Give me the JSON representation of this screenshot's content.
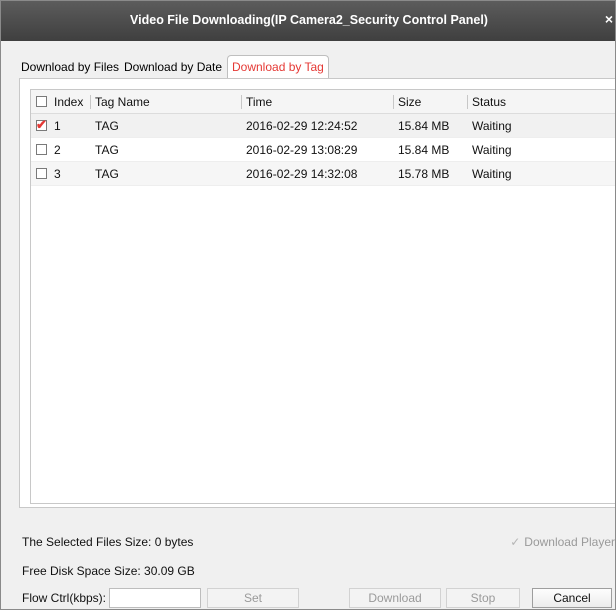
{
  "window": {
    "title": "Video File Downloading(IP Camera2_Security Control Panel)",
    "close_symbol": "×"
  },
  "tabs": [
    {
      "label": "Download by Files",
      "active": false
    },
    {
      "label": "Download by Date",
      "active": false
    },
    {
      "label": "Download by Tag",
      "active": true
    }
  ],
  "table": {
    "columns": {
      "index": "Index",
      "tag_name": "Tag Name",
      "time": "Time",
      "size": "Size",
      "status": "Status"
    },
    "rows": [
      {
        "index": "1",
        "tag_name": "TAG",
        "time": "2016-02-29 12:24:52",
        "size": "15.84 MB",
        "status": "Waiting",
        "checked": true
      },
      {
        "index": "2",
        "tag_name": "TAG",
        "time": "2016-02-29 13:08:29",
        "size": "15.84 MB",
        "status": "Waiting",
        "checked": false
      },
      {
        "index": "3",
        "tag_name": "TAG",
        "time": "2016-02-29 14:32:08",
        "size": "15.78 MB",
        "status": "Waiting",
        "checked": false
      }
    ]
  },
  "footer": {
    "selected_size_label": "The Selected Files Size:  0 bytes",
    "free_disk_label": "Free Disk Space Size:  30.09 GB",
    "flow_ctrl_label": "Flow Ctrl(kbps):",
    "flow_ctrl_value": "",
    "download_player_label": "Download Player",
    "download_player_checked": true,
    "buttons": {
      "set": "Set",
      "download": "Download",
      "stop": "Stop",
      "cancel": "Cancel"
    }
  },
  "colors": {
    "accent": "#e53935",
    "titlebar": "#4a4a4a"
  },
  "icons": {
    "close": "close-icon",
    "checkbox_checked": "checkmark-icon"
  }
}
